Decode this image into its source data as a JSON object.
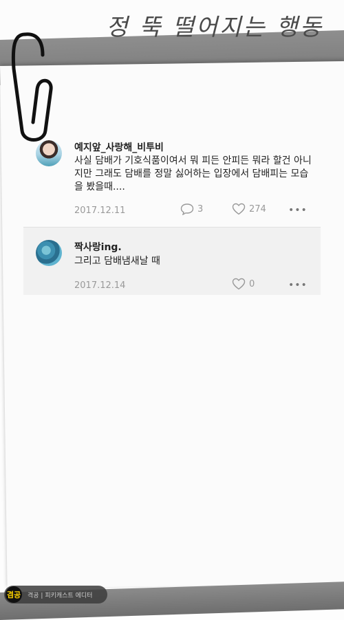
{
  "header": {
    "title": "정 뚝 떨어지는 행동"
  },
  "comments": [
    {
      "author": "예지앞_사랑해_비투비",
      "text": "사실 담배가 기호식품이여서 뭐 피든 안피든 뭐라 할건 아니지만 그래도 담배를 정말 싫어하는 입장에서 담배피는 모습을 봤을때....",
      "date": "2017.12.11",
      "replies": "3",
      "likes": "274"
    },
    {
      "author": "짝사랑ing.",
      "text": "그리고 담배냄새날 때",
      "date": "2017.12.14",
      "likes": "0"
    }
  ],
  "footer": {
    "logo": "겸공",
    "text": "격공 | 피키캐스트 에디터"
  },
  "icons": {
    "reply": "speech-bubble-icon",
    "like": "heart-icon",
    "more": "more-dots-icon",
    "clip": "paperclip-icon"
  },
  "colors": {
    "band": "#7f7f7f",
    "meta": "#999999",
    "text": "#222222",
    "logo_accent": "#ffd400"
  }
}
